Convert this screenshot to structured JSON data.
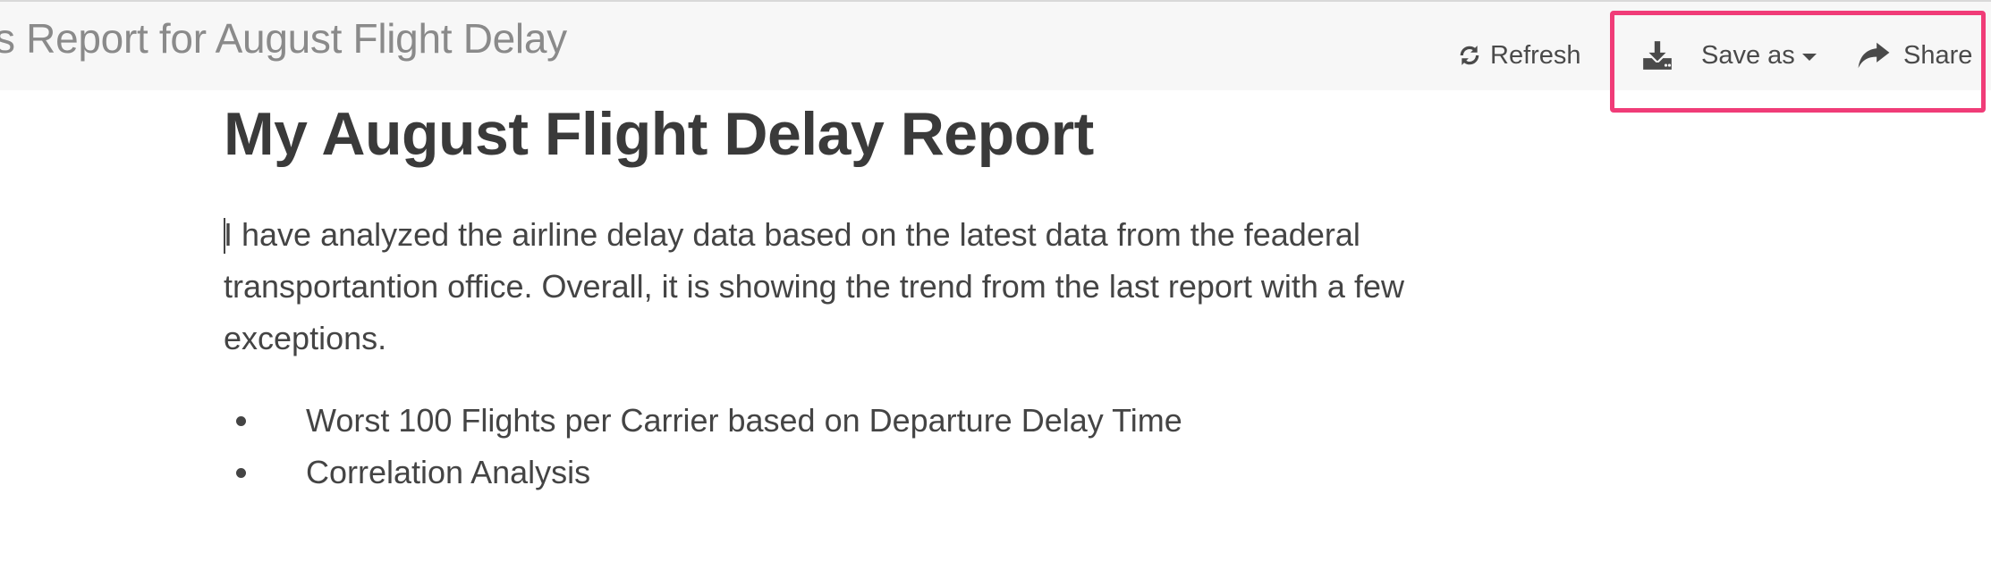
{
  "header": {
    "doc_title": "s Report for August Flight Delay",
    "refresh_label": "Refresh",
    "saveas_label": "Save as",
    "share_label": "Share"
  },
  "icons": {
    "refresh": "refresh-icon",
    "download": "download-icon",
    "caret": "caret-down-icon",
    "share": "share-arrow-icon"
  },
  "colors": {
    "highlight": "#f03c78",
    "topbar_bg": "#f7f7f7"
  },
  "report": {
    "title": "My August Flight Delay Report",
    "paragraph": "I have analyzed the airline delay data based on the latest data from the feaderal transportantion office. Overall, it is showing the trend from the last report with a few exceptions.",
    "bullets": [
      "Worst 100 Flights per Carrier based on Departure Delay Time",
      "Correlation Analysis"
    ]
  }
}
